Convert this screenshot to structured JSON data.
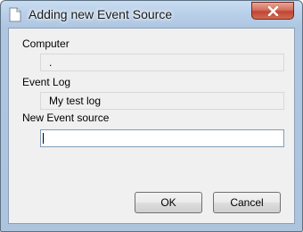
{
  "window": {
    "title": "Adding new Event Source",
    "title_icon": "document-icon",
    "close_icon": "close-icon"
  },
  "form": {
    "computer_label": "Computer",
    "computer_value": ".",
    "event_log_label": "Event Log",
    "event_log_value": "My test log",
    "new_source_label": "New Event source",
    "new_source_value": ""
  },
  "buttons": {
    "ok_label": "OK",
    "cancel_label": "Cancel"
  },
  "colors": {
    "frame_accent": "#b9d0e9",
    "close_red": "#c14533",
    "input_border": "#7f9db9"
  }
}
